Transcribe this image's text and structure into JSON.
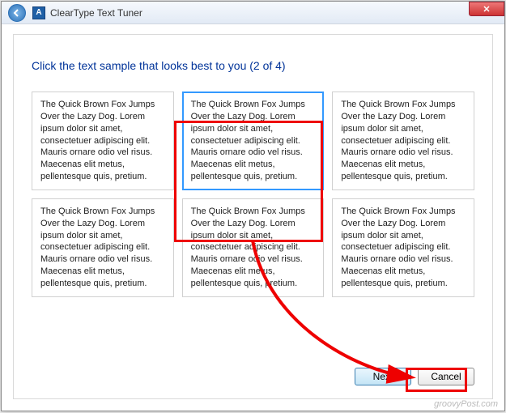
{
  "window": {
    "title": "ClearType Text Tuner",
    "app_icon_letter": "A"
  },
  "heading": "Click the text sample that looks best to you (2 of 4)",
  "sample_text": "The Quick Brown Fox Jumps Over the Lazy Dog. Lorem ipsum dolor sit amet, consectetuer adipiscing elit. Mauris ornare odio vel risus. Maecenas elit metus, pellentesque quis, pretium.",
  "selected_index": 1,
  "buttons": {
    "next": "Next",
    "cancel": "Cancel"
  },
  "watermark": "groovyPost.com"
}
